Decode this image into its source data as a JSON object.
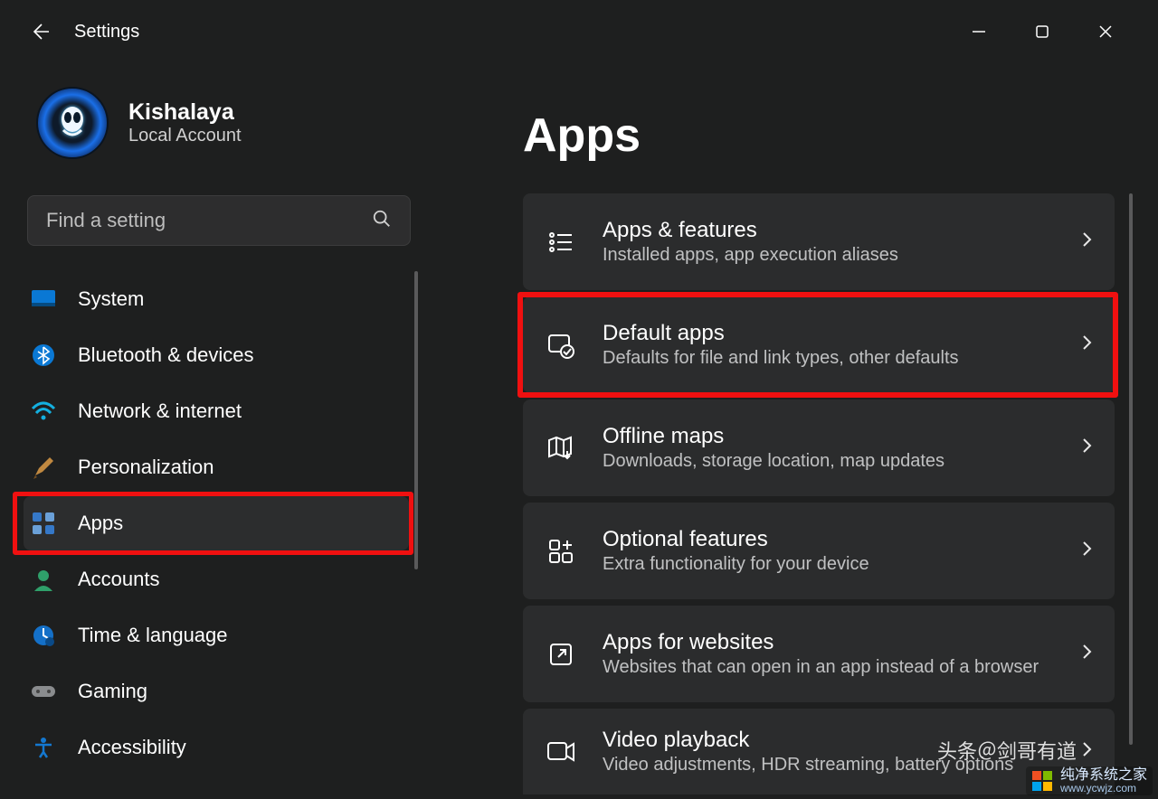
{
  "window": {
    "title": "Settings"
  },
  "profile": {
    "name": "Kishalaya",
    "sub": "Local Account"
  },
  "search": {
    "placeholder": "Find a setting"
  },
  "sidebar": {
    "items": [
      {
        "label": "System"
      },
      {
        "label": "Bluetooth & devices"
      },
      {
        "label": "Network & internet"
      },
      {
        "label": "Personalization"
      },
      {
        "label": "Apps"
      },
      {
        "label": "Accounts"
      },
      {
        "label": "Time & language"
      },
      {
        "label": "Gaming"
      },
      {
        "label": "Accessibility"
      }
    ]
  },
  "page": {
    "title": "Apps",
    "cards": [
      {
        "title": "Apps & features",
        "sub": "Installed apps, app execution aliases"
      },
      {
        "title": "Default apps",
        "sub": "Defaults for file and link types, other defaults"
      },
      {
        "title": "Offline maps",
        "sub": "Downloads, storage location, map updates"
      },
      {
        "title": "Optional features",
        "sub": "Extra functionality for your device"
      },
      {
        "title": "Apps for websites",
        "sub": "Websites that can open in an app instead of a browser"
      },
      {
        "title": "Video playback",
        "sub": "Video adjustments, HDR streaming, battery options"
      }
    ]
  },
  "watermark": {
    "top": "头条＠剑哥有道",
    "brand": "纯净系统之家",
    "url": "www.ycwjz.com"
  }
}
